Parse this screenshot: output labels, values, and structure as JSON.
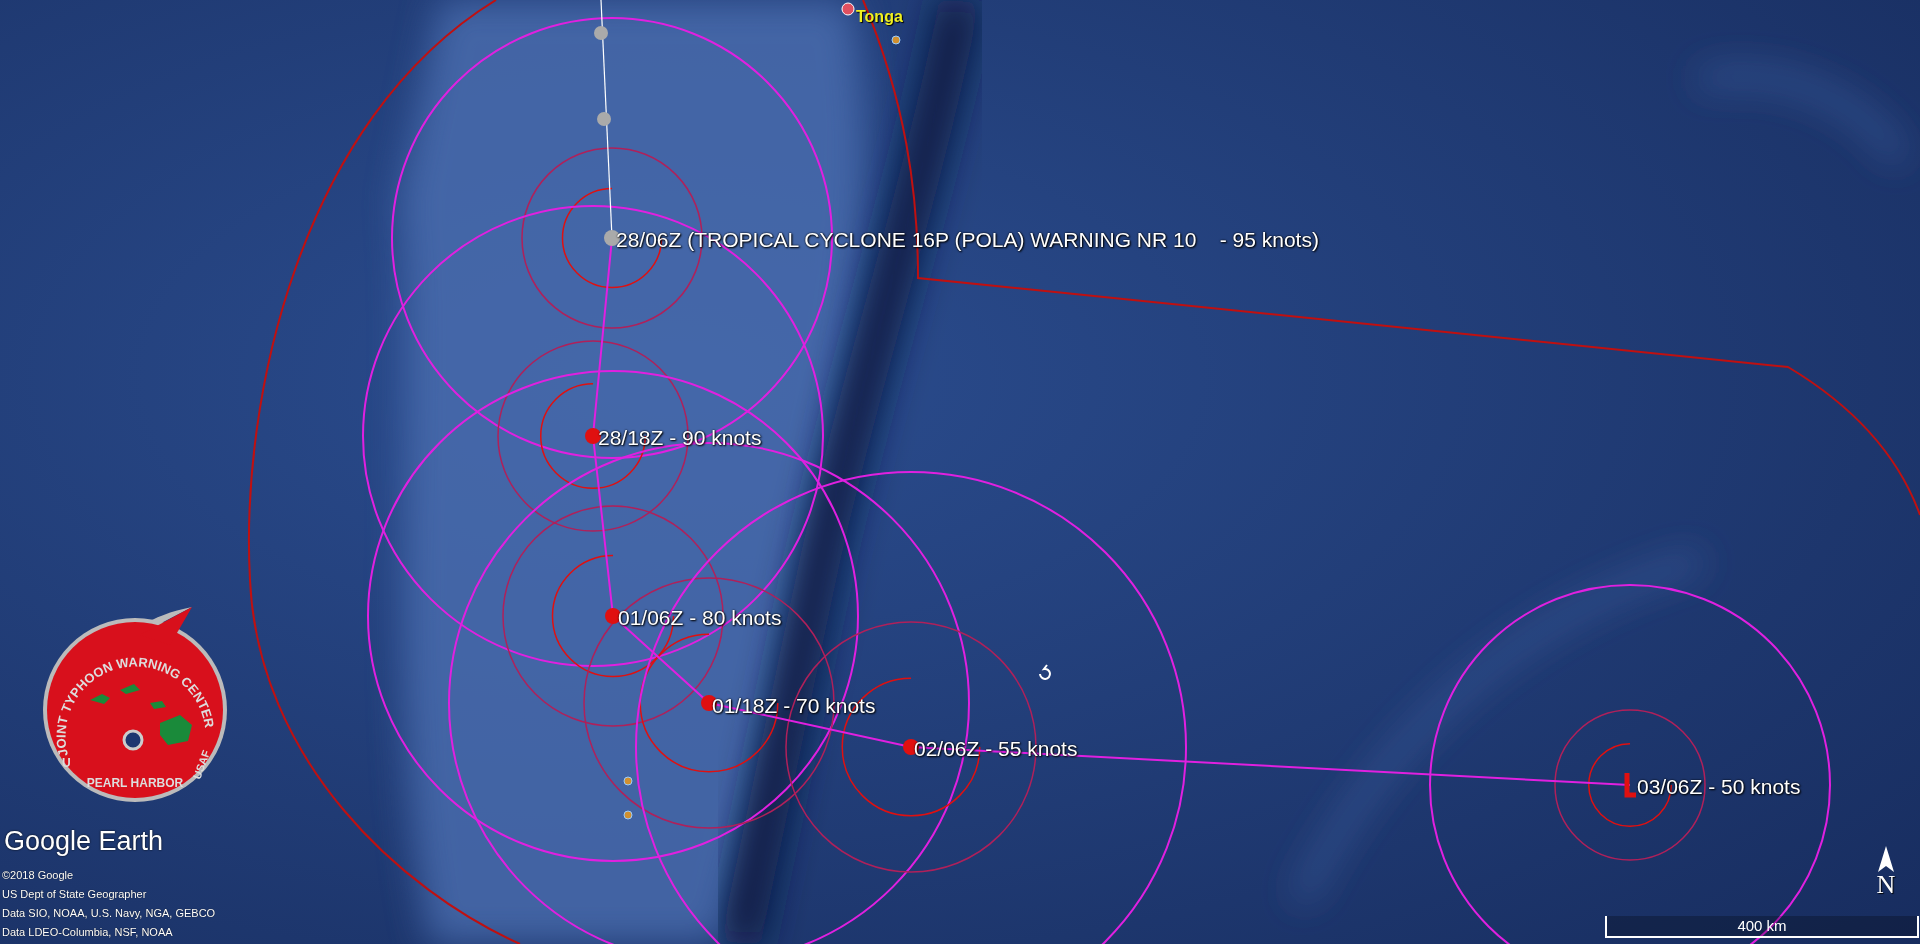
{
  "map": {
    "place_label": "Tonga",
    "warning_points": [
      {
        "label": "28/06Z (TROPICAL CYCLONE 16P (POLA) WARNING NR 10    - 95 knots)",
        "kind": "current"
      },
      {
        "label": "28/18Z - 90 knots",
        "kind": "forecast"
      },
      {
        "label": "01/06Z - 80 knots",
        "kind": "forecast"
      },
      {
        "label": "01/18Z - 70 knots",
        "kind": "forecast"
      },
      {
        "label": "02/06Z - 55 knots",
        "kind": "forecast"
      },
      {
        "label": "03/06Z - 50 knots",
        "kind": "final"
      }
    ]
  },
  "logo": {
    "title": "JOINT TYPHOON WARNING CENTER",
    "location": "PEARL HARBOR",
    "side_left": "U",
    "side_right": "USAF"
  },
  "brand": "Google Earth",
  "attribution": [
    "©2018 Google",
    "US Dept of State Geographer",
    "Data SIO, NOAA, U.S. Navy, NGA, GEBCO",
    "Data LDEO-Columbia, NSF, NOAA"
  ],
  "scale": "400 km",
  "compass": "N"
}
